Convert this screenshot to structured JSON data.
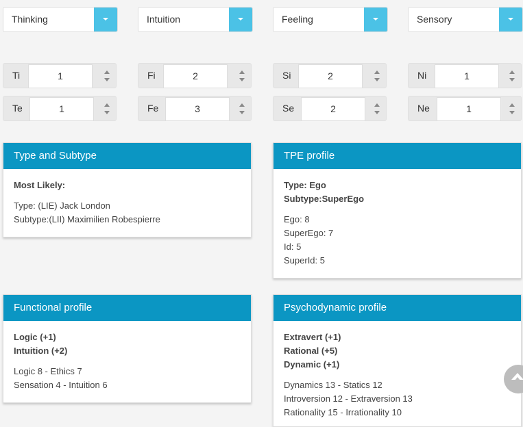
{
  "selects": [
    {
      "value": "Thinking"
    },
    {
      "value": "Intuition"
    },
    {
      "value": "Feeling"
    },
    {
      "value": "Sensory"
    }
  ],
  "spinners": {
    "row1": [
      {
        "label": "Ti",
        "value": "1"
      },
      {
        "label": "Fi",
        "value": "2"
      },
      {
        "label": "Si",
        "value": "2"
      },
      {
        "label": "Ni",
        "value": "1"
      }
    ],
    "row2": [
      {
        "label": "Te",
        "value": "1"
      },
      {
        "label": "Fe",
        "value": "3"
      },
      {
        "label": "Se",
        "value": "2"
      },
      {
        "label": "Ne",
        "value": "1"
      }
    ]
  },
  "cards": {
    "type_subtype": {
      "title": "Type and Subtype",
      "bold": [
        "Most Likely:"
      ],
      "lines": [
        "Type: (LIE) Jack London",
        "Subtype:(LII) Maximilien Robespierre"
      ]
    },
    "tpe": {
      "title": "TPE profile",
      "bold": [
        "Type: Ego",
        "Subtype:SuperEgo"
      ],
      "lines": [
        "Ego: 8",
        "SuperEgo: 7",
        "Id: 5",
        "SuperId: 5"
      ]
    },
    "functional": {
      "title": "Functional profile",
      "bold": [
        "Logic (+1)",
        "Intuition (+2)"
      ],
      "lines": [
        "Logic 8 - Ethics 7",
        "Sensation 4 - Intuition 6"
      ]
    },
    "psychodynamic": {
      "title": "Psychodynamic profile",
      "bold": [
        "Extravert (+1)",
        "Rational (+5)",
        "Dynamic (+1)"
      ],
      "lines": [
        "Dynamics 13 - Statics 12",
        "Introversion 12 - Extraversion 13",
        "Rationality 15 - Irrationality 10"
      ]
    }
  },
  "icons": {
    "dropdown": "chevron-down-icon",
    "spinner": "spinner-arrows-icon",
    "scroll_top": "arrow-up-icon"
  },
  "colors": {
    "card_header": "#0b96c3",
    "select_button": "#4bc2e6"
  }
}
